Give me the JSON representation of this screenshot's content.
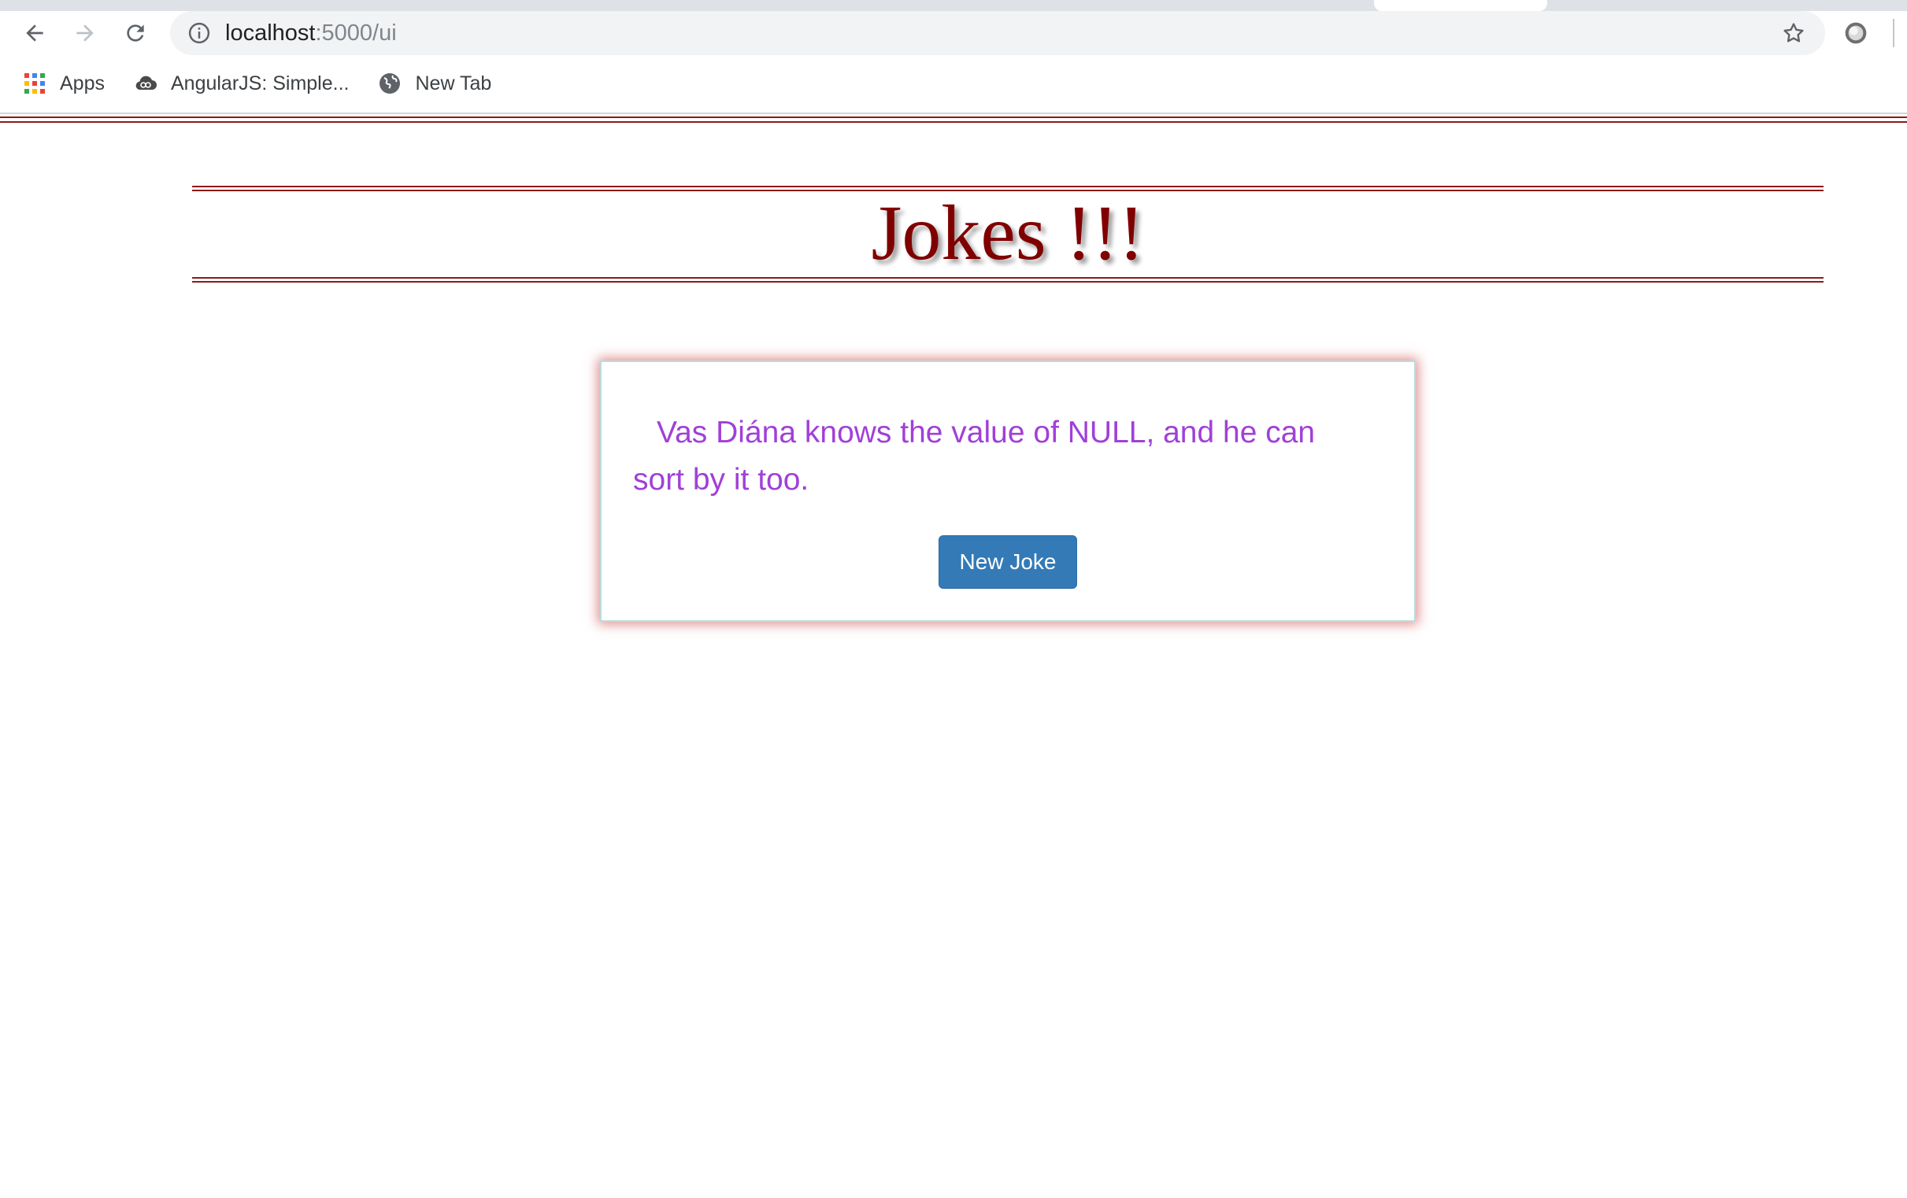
{
  "browser": {
    "url_host": "localhost",
    "url_path": ":5000/ui",
    "bookmarks": [
      {
        "label": "Apps",
        "icon": "apps-grid-icon"
      },
      {
        "label": "AngularJS: Simple...",
        "icon": "cloud-icon"
      },
      {
        "label": "New Tab",
        "icon": "globe-icon"
      }
    ]
  },
  "page": {
    "title": "Jokes !!!",
    "title_color": "#800000",
    "joke": {
      "text": "Vas Diána knows the value of NULL, and he can sort by it too.",
      "text_color": "#a040d8"
    },
    "new_joke_label": "New Joke",
    "button_color": "#337ab7"
  }
}
